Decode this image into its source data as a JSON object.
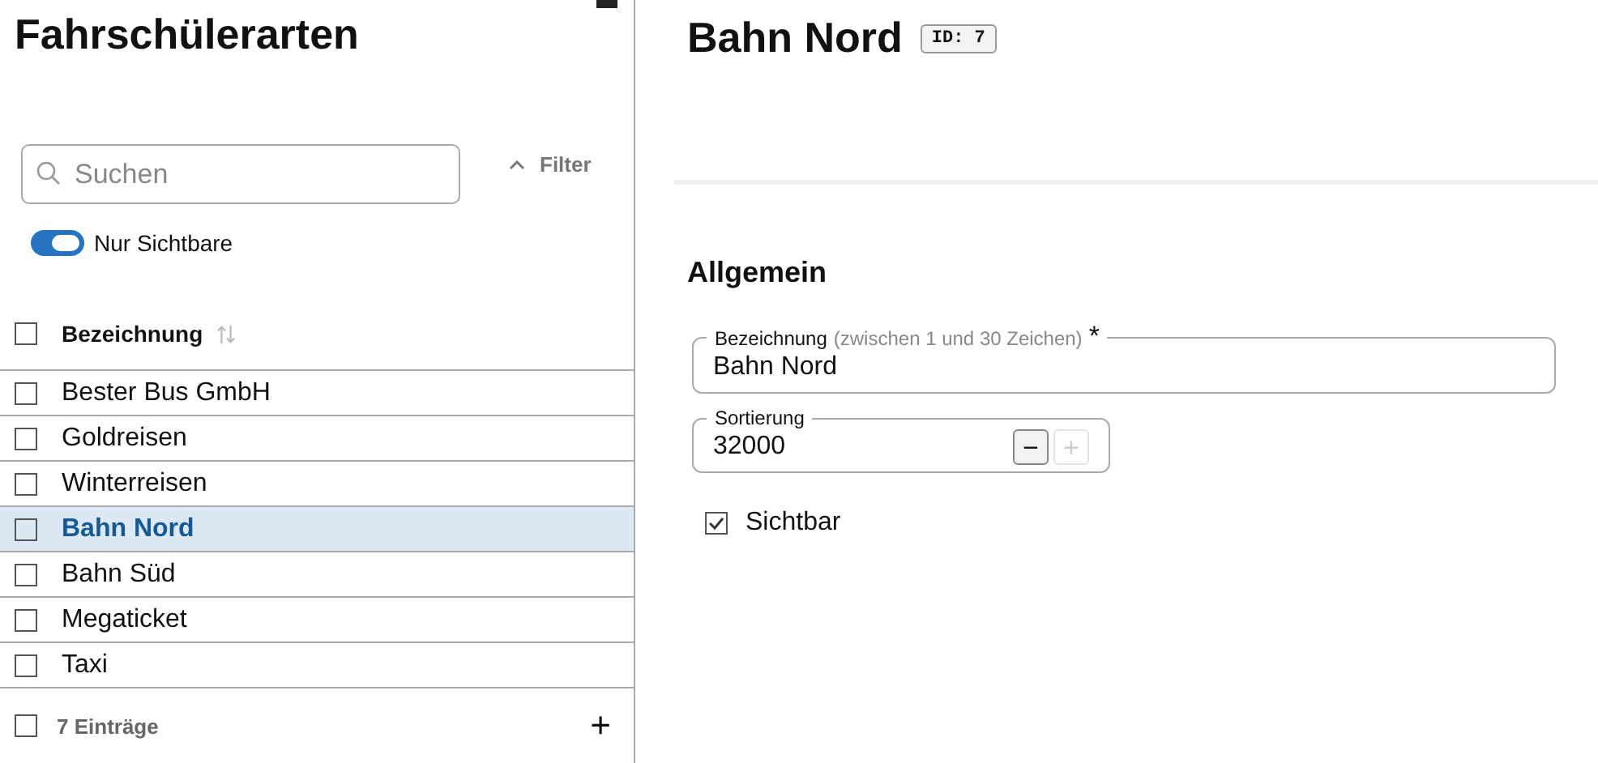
{
  "list_panel": {
    "title": "Fahrschülerarten",
    "search": {
      "placeholder": "Suchen"
    },
    "filter_button": "Filter",
    "visible_only_toggle": {
      "label": "Nur Sichtbare",
      "on": true
    },
    "table": {
      "column": "Bezeichnung",
      "header_checked": false,
      "rows": [
        {
          "name": "Bester Bus GmbH",
          "checked": false,
          "selected": false
        },
        {
          "name": "Goldreisen",
          "checked": false,
          "selected": false
        },
        {
          "name": "Winterreisen",
          "checked": false,
          "selected": false
        },
        {
          "name": "Bahn Nord",
          "checked": false,
          "selected": true
        },
        {
          "name": "Bahn Süd",
          "checked": false,
          "selected": false
        },
        {
          "name": "Megaticket",
          "checked": false,
          "selected": false
        },
        {
          "name": "Taxi",
          "checked": false,
          "selected": false
        }
      ]
    },
    "footer": {
      "count": "7 Einträge",
      "checked": false,
      "add_button": "+"
    }
  },
  "detail": {
    "title": "Bahn Nord",
    "id_badge": "ID: 7",
    "section": "Allgemein",
    "name_field": {
      "label": "Bezeichnung",
      "hint": "(zwischen 1 und 30 Zeichen)",
      "required_mark": "*",
      "value": "Bahn Nord"
    },
    "sort_field": {
      "label": "Sortierung",
      "value": "32000",
      "buttons": [
        {
          "label": "−",
          "disabled": false
        },
        {
          "label": "+",
          "disabled": true
        }
      ]
    },
    "visible_checkbox": {
      "label": "Sichtbar",
      "checked": true
    }
  }
}
